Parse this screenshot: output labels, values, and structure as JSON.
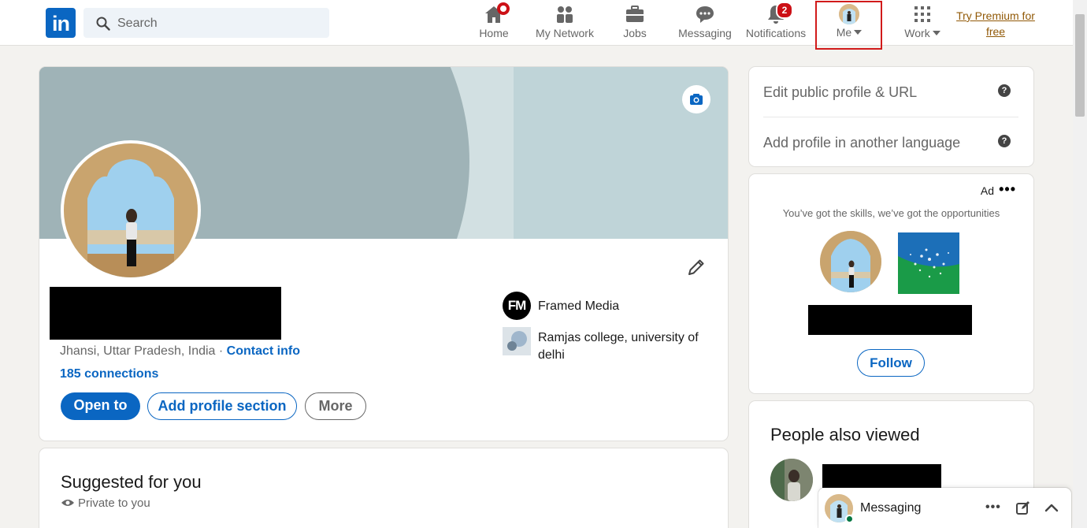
{
  "nav": {
    "logo_text": "in",
    "search_placeholder": "Search",
    "items": [
      {
        "label": "Home",
        "icon": "home-icon"
      },
      {
        "label": "My Network",
        "icon": "network-icon"
      },
      {
        "label": "Jobs",
        "icon": "briefcase-icon"
      },
      {
        "label": "Messaging",
        "icon": "message-icon"
      },
      {
        "label": "Notifications",
        "icon": "bell-icon",
        "badge": "2"
      },
      {
        "label": "Me",
        "icon": "avatar"
      },
      {
        "label": "Work",
        "icon": "grid-icon"
      }
    ],
    "premium_line1": "Try Premium for",
    "premium_line2": "free"
  },
  "profile": {
    "location": "Jhansi, Uttar Pradesh, India",
    "separator": "·",
    "contact_info": "Contact info",
    "connections": "185 connections",
    "buttons": {
      "open_to": "Open to",
      "add_section": "Add profile section",
      "more": "More"
    },
    "experience": {
      "logo": "FM",
      "name": "Framed Media"
    },
    "education": {
      "name": "Ramjas college, university of delhi"
    }
  },
  "suggested": {
    "title": "Suggested for you",
    "privacy": "Private to you"
  },
  "sidebar": {
    "edit_url": "Edit public profile & URL",
    "add_language": "Add profile in another language",
    "help_glyph": "?",
    "ad": {
      "label": "Ad",
      "menu_glyph": "•••",
      "tagline": "You’ve got the skills, we’ve got the opportunities",
      "follow": "Follow"
    },
    "people_also_viewed": "People also viewed"
  },
  "messaging": {
    "label": "Messaging",
    "menu_glyph": "•••"
  },
  "colors": {
    "brand": "#0a66c2",
    "badge": "#cc1016",
    "premium": "#915907",
    "highlight_box": "#d11a1a"
  }
}
